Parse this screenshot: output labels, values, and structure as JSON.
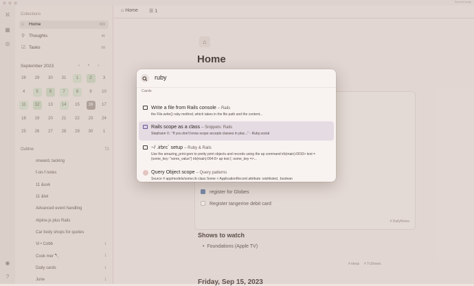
{
  "titlebar": {
    "sync": "Synced today"
  },
  "sidebar": {
    "header": "Collections",
    "items": [
      {
        "label": "Home",
        "count": "699"
      },
      {
        "label": "Thoughts",
        "count": "46"
      },
      {
        "label": "Tasks",
        "count": "68"
      }
    ],
    "month": "September 2023",
    "days": [
      "28",
      "29",
      "30",
      "31",
      "1",
      "2",
      "3",
      "4",
      "5",
      "6",
      "7",
      "8",
      "9",
      "10",
      "11",
      "12",
      "13",
      "14",
      "15",
      "16",
      "17",
      "18",
      "19",
      "20",
      "21",
      "22",
      "23",
      "24",
      "25",
      "26",
      "27",
      "28",
      "29",
      "30",
      "1"
    ],
    "outline_header": "Outline",
    "outline_count": "72",
    "outline": [
      {
        "label": "onward, tacking",
        "count": ""
      },
      {
        "label": "f-on-f notes",
        "count": ""
      },
      {
        "label": "11 &uvk",
        "count": ""
      },
      {
        "label": "11 &tel",
        "count": ""
      },
      {
        "label": "Advanced event handling",
        "count": ""
      },
      {
        "label": "Alpine.js plus Rails",
        "count": ""
      },
      {
        "label": "Car body shops for quotes",
        "count": ""
      },
      {
        "label": "Vi • Cobb",
        "count": "1"
      },
      {
        "label": "Cook mer 🔪",
        "count": "1"
      },
      {
        "label": "Daily cards",
        "count": "1"
      },
      {
        "label": "June",
        "count": "1"
      }
    ]
  },
  "tabs": [
    {
      "label": "Home"
    },
    {
      "label": "1"
    }
  ],
  "main": {
    "title": "Home",
    "tasks": [
      {
        "label": "register for Globes",
        "done": true
      },
      {
        "label": "Register tangerine debit card",
        "done": false
      }
    ],
    "tag": "# DailyNotes",
    "shows_title": "Shows to watch",
    "shows": [
      "Foundations (Apple TV)"
    ],
    "shows_footer": [
      "# ideas",
      "# TvShows"
    ],
    "date_heading": "Friday, Sep 15, 2023"
  },
  "palette": {
    "query": "ruby",
    "section": "Cards",
    "results": [
      {
        "title": "Write a file from Rails console",
        "collection": "Rails",
        "snippet": "the File.write() ruby method, which takes in the file path and the content..."
      },
      {
        "title": "Rails scope as a class",
        "collection": "Snippets: Rails",
        "snippet": "Stephann V.: \"If you don't know scope accepts classes in plac...\" - Ruby.social"
      },
      {
        "title": "~/ .irbrc` setup",
        "collection": "Ruby & Rails",
        "snippet": "Use the amazing_print gem to pretty print objects and records using the ap command irb(main):0010> test = {some_key: \"some_value\"} irb(main):004:0> ap test { :some_key =>..."
      },
      {
        "title": "Query Object scope",
        "collection": "Query patterns",
        "snippet": "Source # app/models/some.rb class Some < ApplicationRecord attribute :wishlisted, :boolean"
      }
    ]
  }
}
